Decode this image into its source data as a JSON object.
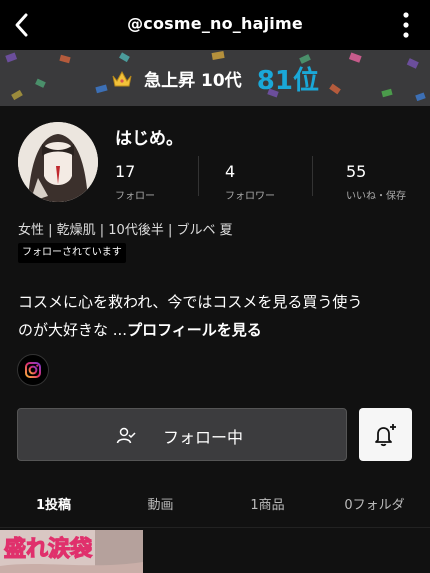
{
  "header": {
    "handle": "@cosme_no_hajime"
  },
  "ranking": {
    "label": "急上昇 10代",
    "rank": "81位"
  },
  "profile": {
    "name": "はじめ。",
    "stats": [
      {
        "value": "17",
        "label": "フォロー"
      },
      {
        "value": "4",
        "label": "フォロワー"
      },
      {
        "value": "55",
        "label": "いいね・保存"
      }
    ],
    "attributes": "女性 | 乾燥肌 | 10代後半 | ブルベ 夏",
    "follows_you": "フォローされています",
    "bio_line1": "コスメに心を救われ、今ではコスメを見る買う使う",
    "bio_line2": "のが大好きな ...",
    "bio_more": "プロフィールを見る"
  },
  "actions": {
    "follow_label": "フォロー中"
  },
  "tabs": [
    {
      "label": "1投稿",
      "active": true
    },
    {
      "label": "動画",
      "active": false
    },
    {
      "label": "1商品",
      "active": false
    },
    {
      "label": "0フォルダ",
      "active": false
    }
  ],
  "thumbnail": {
    "text": "盛れ涙袋"
  },
  "colors": {
    "accent": "#1aa8d8",
    "background": "#111111",
    "banner": "#3a3a3c"
  },
  "icons": [
    "back-arrow-icon",
    "more-vertical-icon",
    "crown-icon",
    "instagram-icon",
    "user-check-icon",
    "bell-plus-icon"
  ]
}
